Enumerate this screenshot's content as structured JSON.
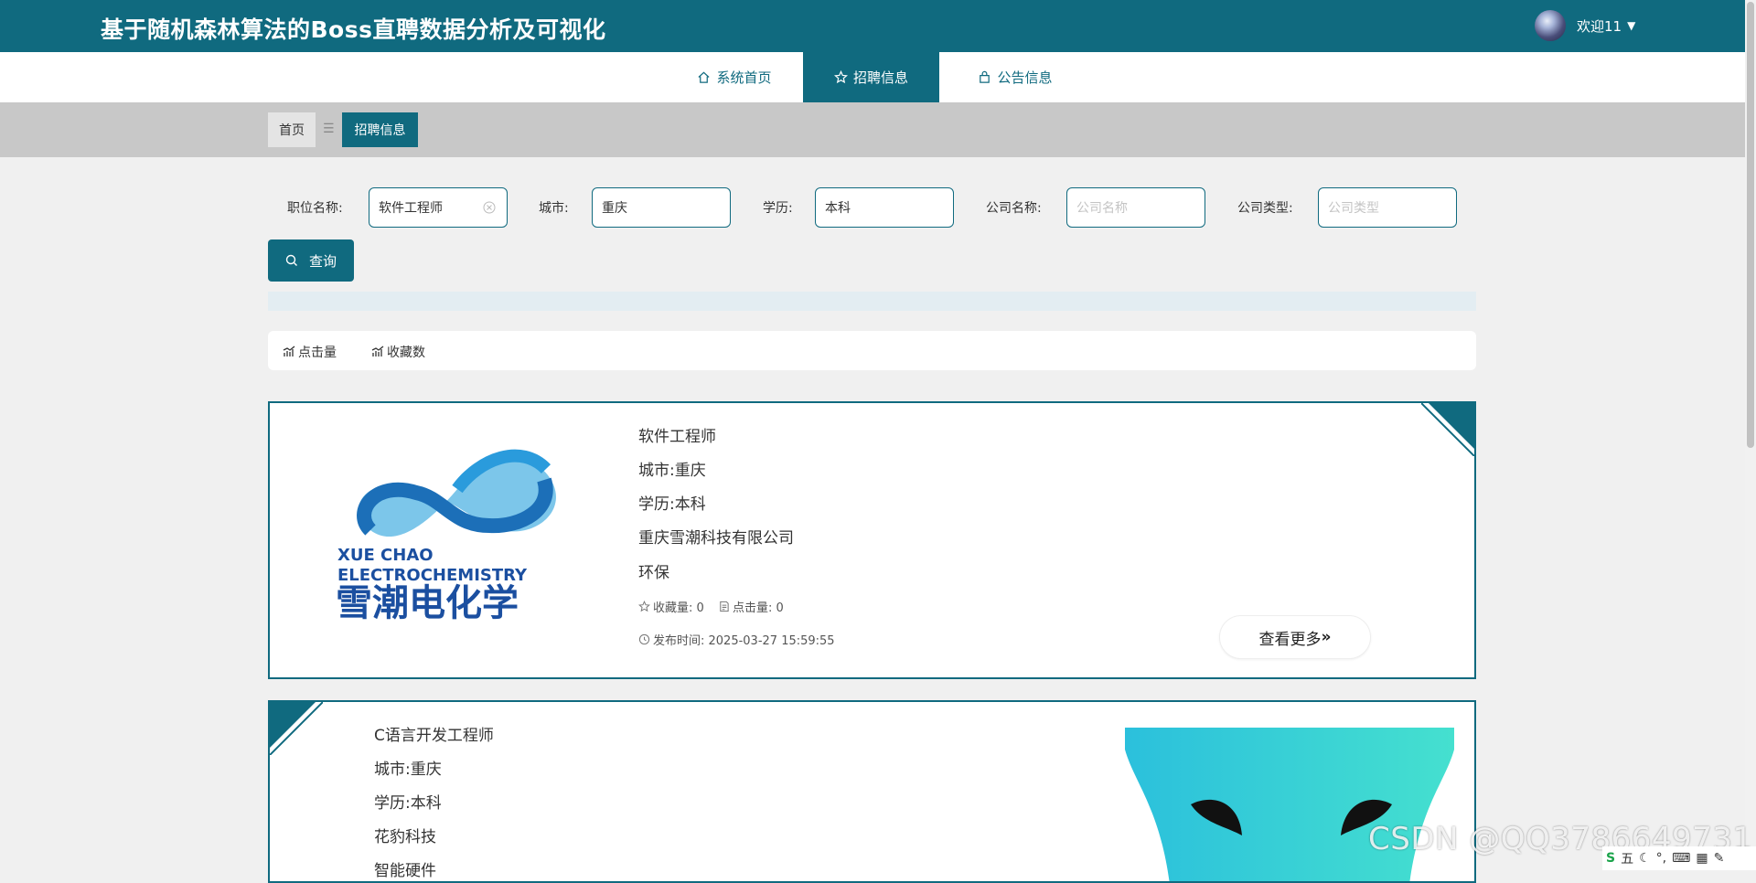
{
  "header": {
    "title": "基于随机森林算法的Boss直聘数据分析及可视化",
    "welcome": "欢迎11"
  },
  "nav": {
    "items": [
      {
        "label": "系统首页",
        "icon": "home-icon"
      },
      {
        "label": "招聘信息",
        "icon": "star-icon"
      },
      {
        "label": "公告信息",
        "icon": "bag-icon"
      }
    ]
  },
  "breadcrumb": {
    "home": "首页",
    "separator": "☰",
    "current": "招聘信息"
  },
  "search": {
    "fields": [
      {
        "label": "职位名称:",
        "value": "软件工程师",
        "placeholder": ""
      },
      {
        "label": "城市:",
        "value": "重庆",
        "placeholder": ""
      },
      {
        "label": "学历:",
        "value": "本科",
        "placeholder": ""
      },
      {
        "label": "公司名称:",
        "value": "",
        "placeholder": "公司名称"
      },
      {
        "label": "公司类型:",
        "value": "",
        "placeholder": "公司类型"
      }
    ],
    "button": "查询"
  },
  "sort": {
    "clicks": "点击量",
    "favorites": "收藏数"
  },
  "jobs": [
    {
      "title": "软件工程师",
      "city": "城市:重庆",
      "education": "学历:本科",
      "company": "重庆雪潮科技有限公司",
      "industry": "环保",
      "favorites": "收藏量: 0",
      "clicks": "点击量: 0",
      "published": "发布时间: 2025-03-27 15:59:55",
      "more": "查看更多",
      "logo": {
        "line1": "XUE CHAO",
        "line2": "ELECTROCHEMISTRY",
        "cn": "雪潮电化学"
      }
    },
    {
      "title": "C语言开发工程师",
      "city": "城市:重庆",
      "education": "学历:本科",
      "company": "花豹科技",
      "industry": "智能硬件"
    }
  ],
  "watermark": "CSDN @QQ3786649731",
  "ime": {
    "mode": "五"
  },
  "colors": {
    "primary": "#106a7f",
    "background": "#f0f0f0",
    "crumbStrip": "#c8c8c8"
  }
}
